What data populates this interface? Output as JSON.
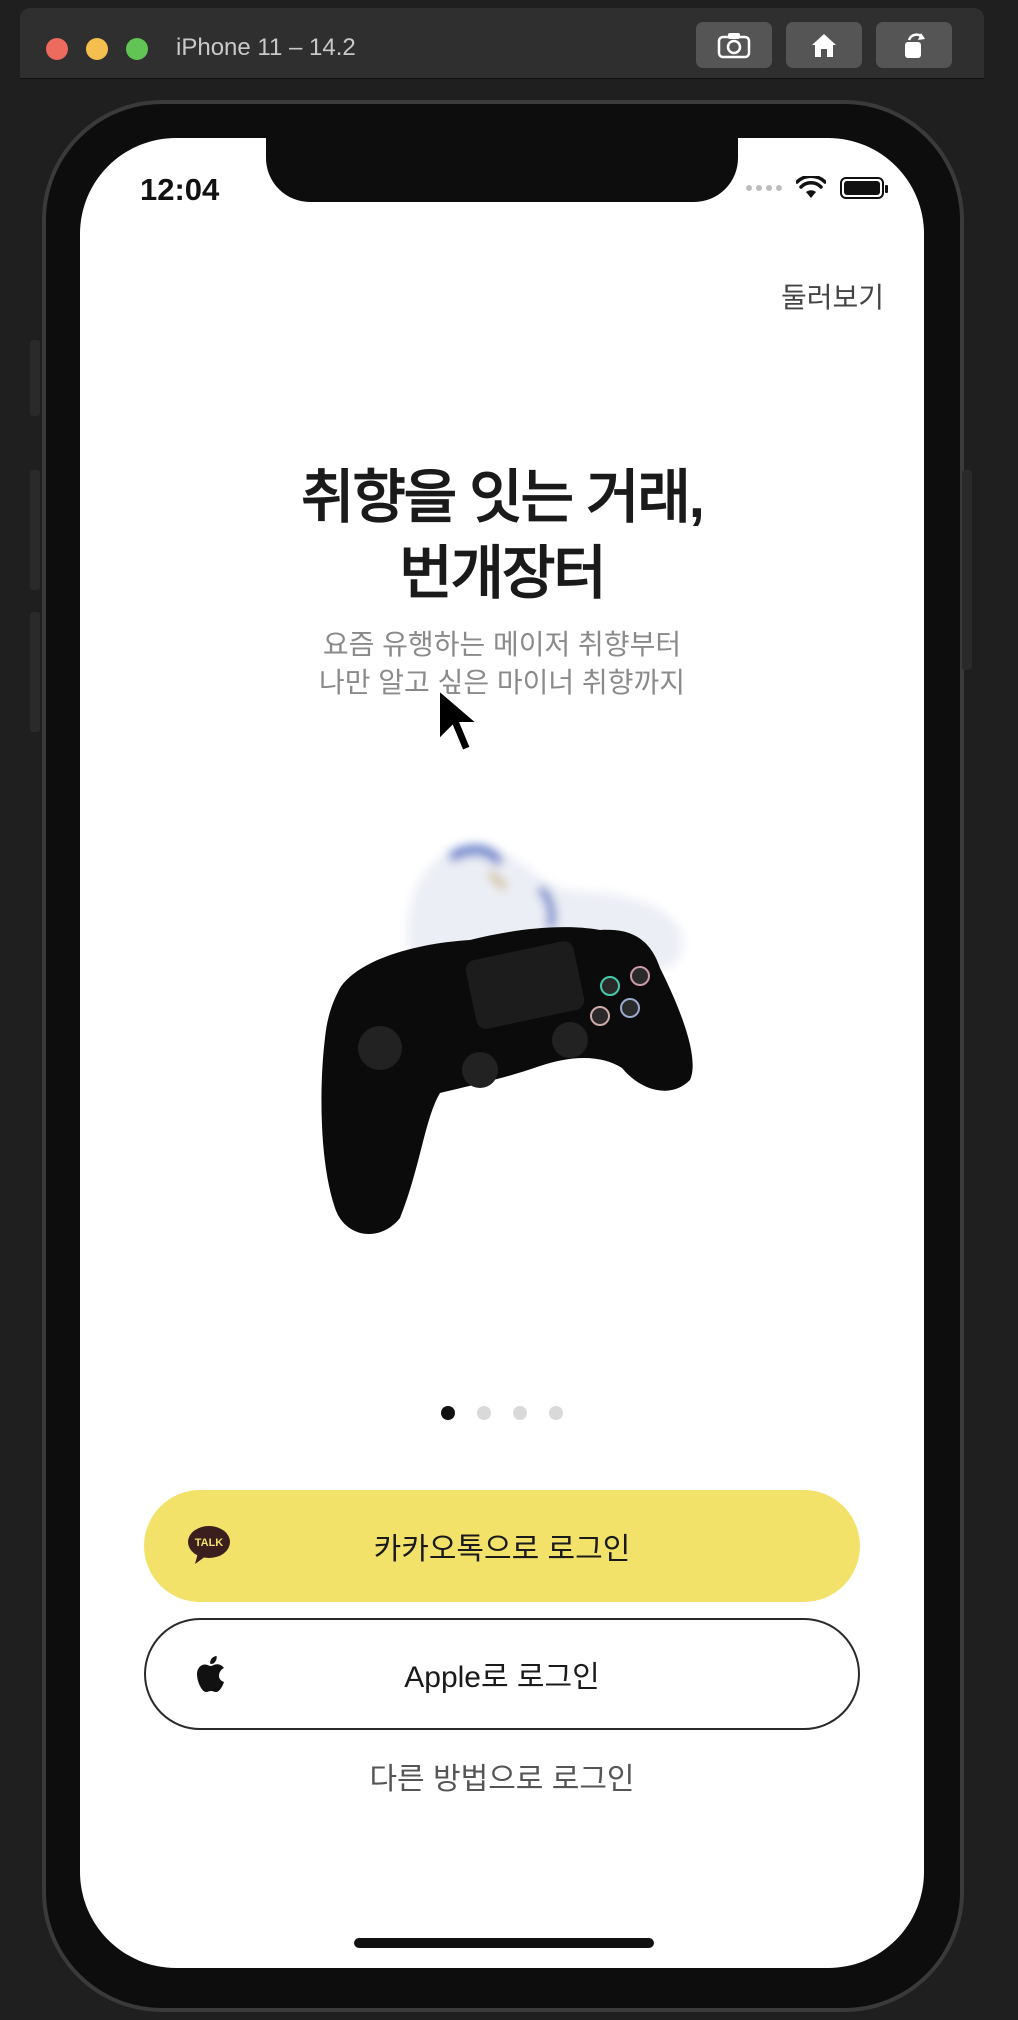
{
  "simulator": {
    "title": "iPhone 11 – 14.2",
    "buttons": [
      "screenshot-icon",
      "home-icon",
      "rotate-icon"
    ]
  },
  "status_bar": {
    "time": "12:04",
    "icons": [
      "wifi-icon",
      "battery-icon"
    ]
  },
  "header": {
    "browse_label": "둘러보기"
  },
  "hero": {
    "title_line1": "취향을 잇는 거래,",
    "title_line2": "번개장터",
    "subtitle_line1": "요즘 유행하는 메이저 취향부터",
    "subtitle_line2": "나만 알고 싶은 마이너 취향까지",
    "image": "game-controller-and-sneaker"
  },
  "pagination": {
    "total": 4,
    "active_index": 0
  },
  "login": {
    "kakao_label": "카카오톡으로 로그인",
    "kakao_icon_text": "TALK",
    "apple_label": "Apple로 로그인",
    "other_label": "다른 방법으로 로그인"
  },
  "colors": {
    "kakao_yellow": "#f2e26a",
    "text_dark": "#1a1a1a",
    "text_gray": "#8a8a8a"
  }
}
